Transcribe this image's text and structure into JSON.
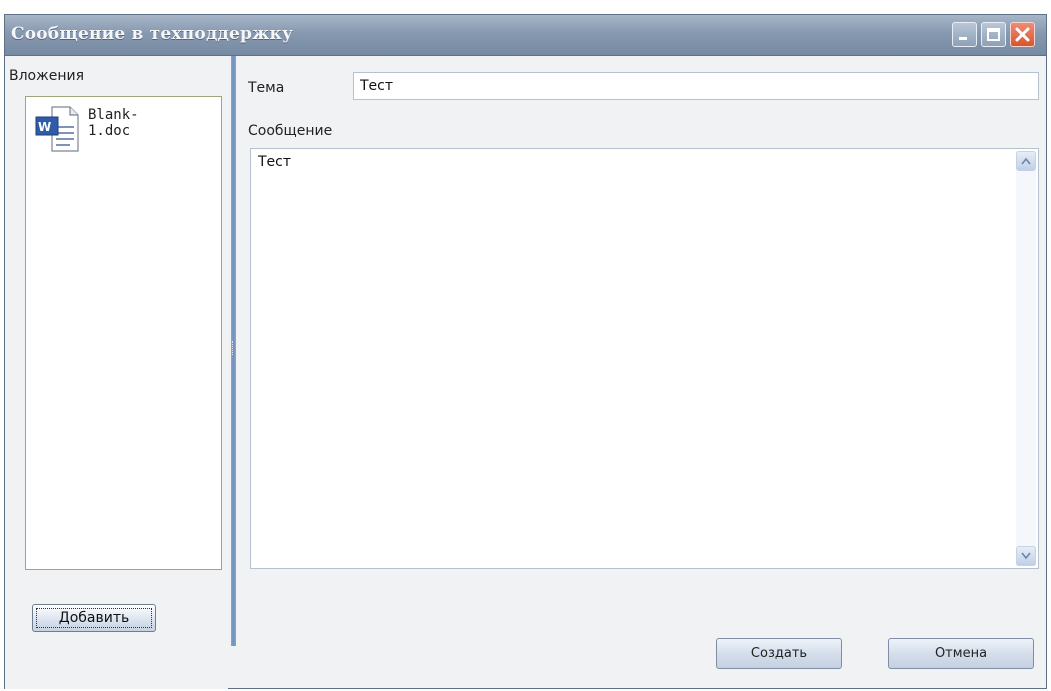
{
  "window": {
    "title": "Сообщение в техподдержку"
  },
  "attachments": {
    "label": "Вложения",
    "items": [
      {
        "name": "Blank-1.doc",
        "icon": "word-document-icon"
      }
    ],
    "add_button": "Добавить"
  },
  "form": {
    "subject_label": "Тема",
    "subject_value": "Тест",
    "message_label": "Сообщение",
    "message_value": "Тест"
  },
  "actions": {
    "create_label": "Создать",
    "cancel_label": "Отмена"
  },
  "colors": {
    "titlebar": "#8799b0",
    "close_button": "#d9542f",
    "splitter": "#6f8fbf"
  }
}
